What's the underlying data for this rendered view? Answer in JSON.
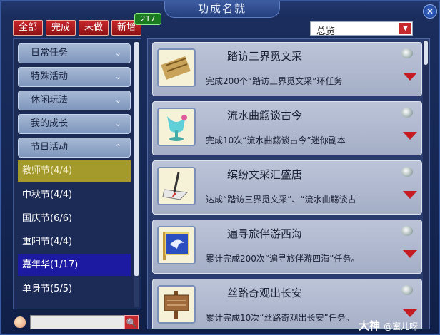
{
  "window": {
    "title": "功成名就",
    "close_label": "✕"
  },
  "tabs": [
    {
      "label": "全部"
    },
    {
      "label": "完成"
    },
    {
      "label": "未做"
    },
    {
      "label": "新增"
    }
  ],
  "new_count": "217",
  "filter": {
    "selected": "总览",
    "arrow": "▼"
  },
  "categories": [
    {
      "label": "日常任务",
      "chevron": "⌄"
    },
    {
      "label": "特殊活动",
      "chevron": "⌄"
    },
    {
      "label": "休闲玩法",
      "chevron": "⌄"
    },
    {
      "label": "我的成长",
      "chevron": "⌄"
    },
    {
      "label": "节日活动",
      "chevron": "⌃"
    }
  ],
  "festivals": [
    {
      "label": "教师节(4/4)"
    },
    {
      "label": "中秋节(4/4)"
    },
    {
      "label": "国庆节(6/6)"
    },
    {
      "label": "重阳节(4/4)"
    },
    {
      "label": "嘉年华(1/17)"
    },
    {
      "label": "单身节(5/5)"
    }
  ],
  "search": {
    "placeholder": "",
    "button": "🔍"
  },
  "achievements": [
    {
      "title": "踏访三界觅文采",
      "desc": "完成200个“踏访三界觅文采”环任务",
      "icon": "bamboo-scroll-icon"
    },
    {
      "title": "流水曲觞谈古今",
      "desc": "完成10次“流水曲觞谈古今”迷你副本",
      "icon": "wine-goblet-icon"
    },
    {
      "title": "缤纷文采汇盛唐",
      "desc": "达成“踏访三界觅文采”、“流水曲觞谈古",
      "icon": "ink-brush-icon"
    },
    {
      "title": "遍寻旅伴游西海",
      "desc": "累计完成200次“遍寻旅伴游四海”任务。",
      "icon": "flag-banner-icon"
    },
    {
      "title": "丝路奇观出长安",
      "desc": "累计完成10次“丝路奇观出长安”任务。",
      "icon": "signpost-icon"
    }
  ],
  "watermark": {
    "brand": "大神",
    "user": "@蜜儿呀"
  }
}
